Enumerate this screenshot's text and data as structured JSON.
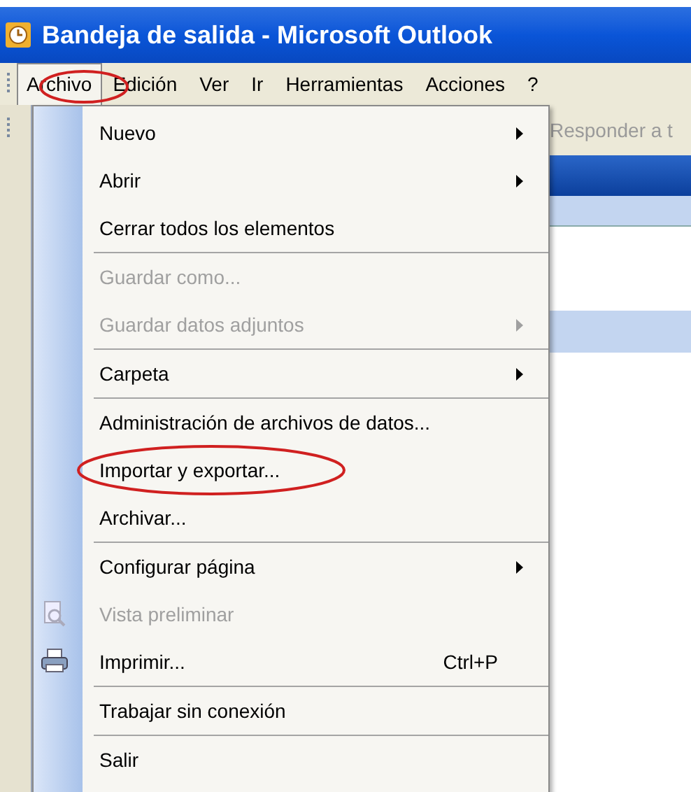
{
  "window": {
    "title": "Bandeja de salida - Microsoft Outlook"
  },
  "menubar": [
    {
      "label": "Archivo",
      "selected": true
    },
    {
      "label": "Edición",
      "selected": false
    },
    {
      "label": "Ver",
      "selected": false
    },
    {
      "label": "Ir",
      "selected": false
    },
    {
      "label": "Herramientas",
      "selected": false
    },
    {
      "label": "Acciones",
      "selected": false
    },
    {
      "label": "?",
      "selected": false
    }
  ],
  "toolbar": {
    "label": "Responder a t"
  },
  "menu": [
    {
      "label": "Nuevo",
      "disabled": false,
      "submenu": true,
      "separator_before": false
    },
    {
      "label": "Abrir",
      "disabled": false,
      "submenu": true,
      "separator_before": false
    },
    {
      "label": "Cerrar todos los elementos",
      "disabled": false,
      "submenu": false,
      "separator_before": false
    },
    {
      "label": "Guardar como...",
      "disabled": true,
      "submenu": false,
      "separator_before": true
    },
    {
      "label": "Guardar datos adjuntos",
      "disabled": true,
      "submenu": true,
      "separator_before": false
    },
    {
      "label": "Carpeta",
      "disabled": false,
      "submenu": true,
      "separator_before": true
    },
    {
      "label": "Administración de archivos de datos...",
      "disabled": false,
      "submenu": false,
      "separator_before": true
    },
    {
      "label": "Importar y exportar...",
      "disabled": false,
      "submenu": false,
      "separator_before": false,
      "circled": true
    },
    {
      "label": "Archivar...",
      "disabled": false,
      "submenu": false,
      "separator_before": false
    },
    {
      "label": "Configurar página",
      "disabled": false,
      "submenu": true,
      "separator_before": true
    },
    {
      "label": "Vista preliminar",
      "disabled": true,
      "submenu": false,
      "separator_before": false,
      "kind": "preview"
    },
    {
      "label": "Imprimir...",
      "disabled": false,
      "submenu": false,
      "separator_before": false,
      "kind": "printer",
      "shortcut": "Ctrl+P"
    },
    {
      "label": "Trabajar sin conexión",
      "disabled": false,
      "submenu": false,
      "separator_before": true
    },
    {
      "label": "Salir",
      "disabled": false,
      "submenu": false,
      "separator_before": true
    }
  ]
}
